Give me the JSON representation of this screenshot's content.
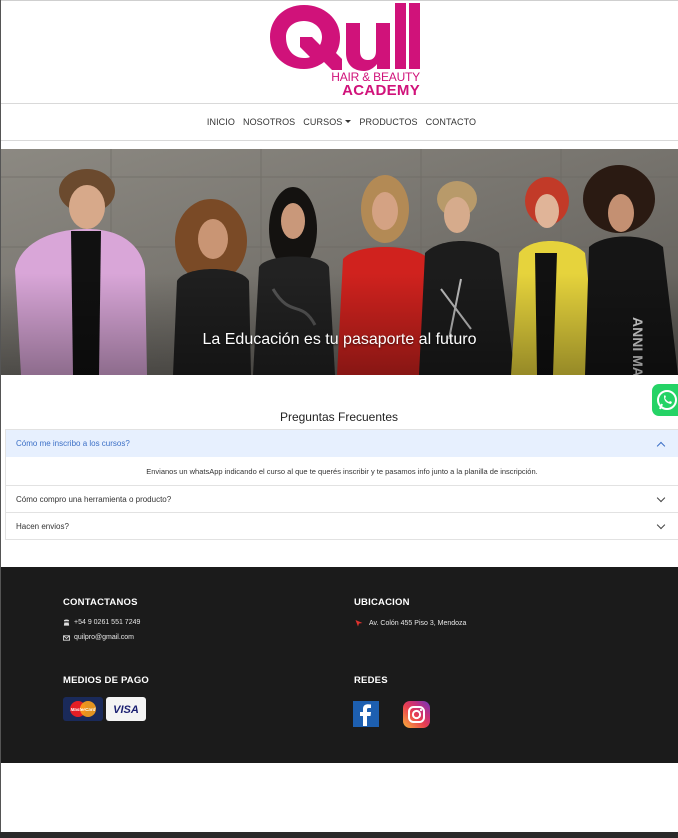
{
  "brand": {
    "logo_word": "Qull",
    "logo_line1": "HAIR & BEAUTY",
    "logo_line2": "ACADEMY",
    "color": "#d0127a"
  },
  "nav": {
    "items": [
      "INICIO",
      "NOSOTROS",
      "CURSOS",
      "PRODUCTOS",
      "CONTACTO"
    ]
  },
  "hero": {
    "caption": "La Educación es tu pasaporte al futuro"
  },
  "faq": {
    "title": "Preguntas Frecuentes",
    "items": [
      {
        "question": "Cómo me inscribo a los cursos?",
        "answer": "Envianos un whatsApp indicando el curso al que te querés inscribir y te pasamos info junto a la planilla de inscripción.",
        "open": true
      },
      {
        "question": "Cómo compro una herramienta o producto?",
        "open": false
      },
      {
        "question": "Hacen envios?",
        "open": false
      }
    ]
  },
  "footer": {
    "contact_title": "CONTACTANOS",
    "phone": "+54 9 0261 551 7249",
    "email": "quilpro@gmail.com",
    "location_title": "UBICACION",
    "address": "Av. Colón 455 Piso 3, Mendoza",
    "payment_title": "MEDIOS DE PAGO",
    "payment_methods": [
      "MasterCard",
      "VISA"
    ],
    "social_title": "REDES",
    "social": [
      "facebook",
      "instagram"
    ]
  },
  "icons": {
    "whatsapp": "whatsapp-icon",
    "phone": "phone-icon",
    "email": "mail-icon",
    "location": "location-pin-icon",
    "facebook": "facebook-icon",
    "instagram": "instagram-icon",
    "chevron": "chevron-icon"
  }
}
